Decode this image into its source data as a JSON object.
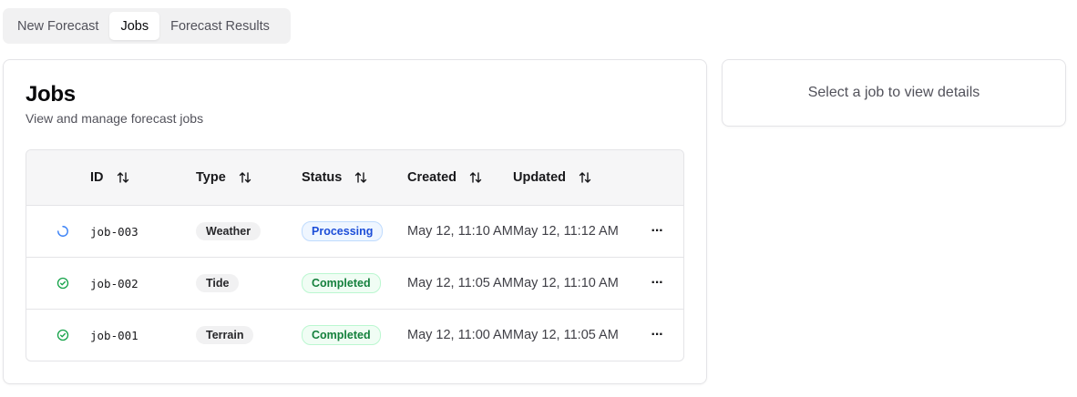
{
  "tabs": [
    {
      "label": "New Forecast",
      "active": false
    },
    {
      "label": "Jobs",
      "active": true
    },
    {
      "label": "Forecast Results",
      "active": false
    }
  ],
  "jobs_card": {
    "title": "Jobs",
    "description": "View and manage forecast jobs"
  },
  "table": {
    "columns": [
      "ID",
      "Type",
      "Status",
      "Created",
      "Updated"
    ],
    "rows": [
      {
        "icon": "loading-spinner-icon",
        "id": "job-003",
        "type": "Weather",
        "status": "Processing",
        "status_kind": "processing",
        "created": "May 12, 11:10 AM",
        "updated": "May 12, 11:12 AM"
      },
      {
        "icon": "check-circle-icon",
        "id": "job-002",
        "type": "Tide",
        "status": "Completed",
        "status_kind": "completed",
        "created": "May 12, 11:05 AM",
        "updated": "May 12, 11:10 AM"
      },
      {
        "icon": "check-circle-icon",
        "id": "job-001",
        "type": "Terrain",
        "status": "Completed",
        "status_kind": "completed",
        "created": "May 12, 11:00 AM",
        "updated": "May 12, 11:05 AM"
      }
    ],
    "row_menu_label": "···"
  },
  "details": {
    "placeholder": "Select a job to view details"
  },
  "colors": {
    "processing": "#1d4ed8",
    "completed": "#15803d",
    "spinner": "#3b82f6",
    "check": "#16a34a"
  }
}
